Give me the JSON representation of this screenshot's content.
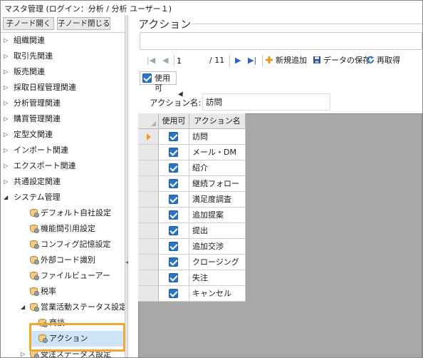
{
  "window": {
    "title": "マスタ管理 (ログイン：分析 / 分析 ユーザー１)"
  },
  "left_pane": {
    "expand_button": "子ノード開く",
    "collapse_button": "子ノード閉じる",
    "tree": [
      {
        "label": "組織関連",
        "level": 0,
        "state": "collapsed"
      },
      {
        "label": "取引先関連",
        "level": 0,
        "state": "collapsed"
      },
      {
        "label": "販売関連",
        "level": 0,
        "state": "collapsed"
      },
      {
        "label": "採取日程管理関連",
        "level": 0,
        "state": "collapsed"
      },
      {
        "label": "分析管理関連",
        "level": 0,
        "state": "collapsed"
      },
      {
        "label": "購買管理関連",
        "level": 0,
        "state": "collapsed"
      },
      {
        "label": "定型文関連",
        "level": 0,
        "state": "collapsed"
      },
      {
        "label": "インポート関連",
        "level": 0,
        "state": "collapsed"
      },
      {
        "label": "エクスポート関連",
        "level": 0,
        "state": "collapsed"
      },
      {
        "label": "共通設定関連",
        "level": 0,
        "state": "collapsed"
      },
      {
        "label": "システム管理",
        "level": 0,
        "state": "expanded"
      },
      {
        "label": "デフォルト自社設定",
        "level": 1,
        "state": "leaf",
        "icon": "database-gear-icon"
      },
      {
        "label": "機能間引用設定",
        "level": 1,
        "state": "leaf",
        "icon": "database-gear-icon"
      },
      {
        "label": "コンフィグ記憶設定",
        "level": 1,
        "state": "leaf",
        "icon": "database-gear-icon"
      },
      {
        "label": "外部コード識別",
        "level": 1,
        "state": "leaf",
        "icon": "database-gear-icon"
      },
      {
        "label": "ファイルビューアー",
        "level": 1,
        "state": "leaf",
        "icon": "database-gear-icon"
      },
      {
        "label": "税率",
        "level": 1,
        "state": "leaf",
        "icon": "database-gear-icon"
      },
      {
        "label": "営業活動ステータス設定",
        "level": 1,
        "state": "expanded",
        "icon": "database-gear-icon"
      },
      {
        "label": "商談",
        "level": 2,
        "state": "leaf",
        "icon": "database-gear-icon"
      },
      {
        "label": "アクション",
        "level": 2,
        "state": "selected",
        "icon": "database-gear-icon"
      },
      {
        "label": "受注ステータス設定",
        "level": 1,
        "state": "collapsed",
        "icon": "database-gear-icon"
      }
    ]
  },
  "right_pane": {
    "title": "アクション",
    "toolbar": {
      "page_current": "1",
      "page_total": "/ 11",
      "add_label": "新規追加",
      "save_label": "データの保存",
      "reload_label": "再取得"
    },
    "enabled_filter_label": "使用可",
    "name_field_label": "アクション名:",
    "name_field_value": "訪問",
    "grid": {
      "columns": [
        "使用可",
        "アクション名"
      ],
      "rows": [
        {
          "enabled": true,
          "name": "訪問",
          "current": true
        },
        {
          "enabled": true,
          "name": "メール・DM"
        },
        {
          "enabled": true,
          "name": "紹介"
        },
        {
          "enabled": true,
          "name": "継続フォロー"
        },
        {
          "enabled": true,
          "name": "満足度調査"
        },
        {
          "enabled": true,
          "name": "追加提案"
        },
        {
          "enabled": true,
          "name": "提出"
        },
        {
          "enabled": true,
          "name": "追加交渉"
        },
        {
          "enabled": true,
          "name": "クロージング"
        },
        {
          "enabled": true,
          "name": "失注"
        },
        {
          "enabled": true,
          "name": "キャンセル"
        }
      ]
    }
  },
  "colors": {
    "accent": "#2a74c6",
    "selection": "#cfe4f7",
    "highlight": "#f0a830",
    "row_pointer": "#e8a020"
  }
}
